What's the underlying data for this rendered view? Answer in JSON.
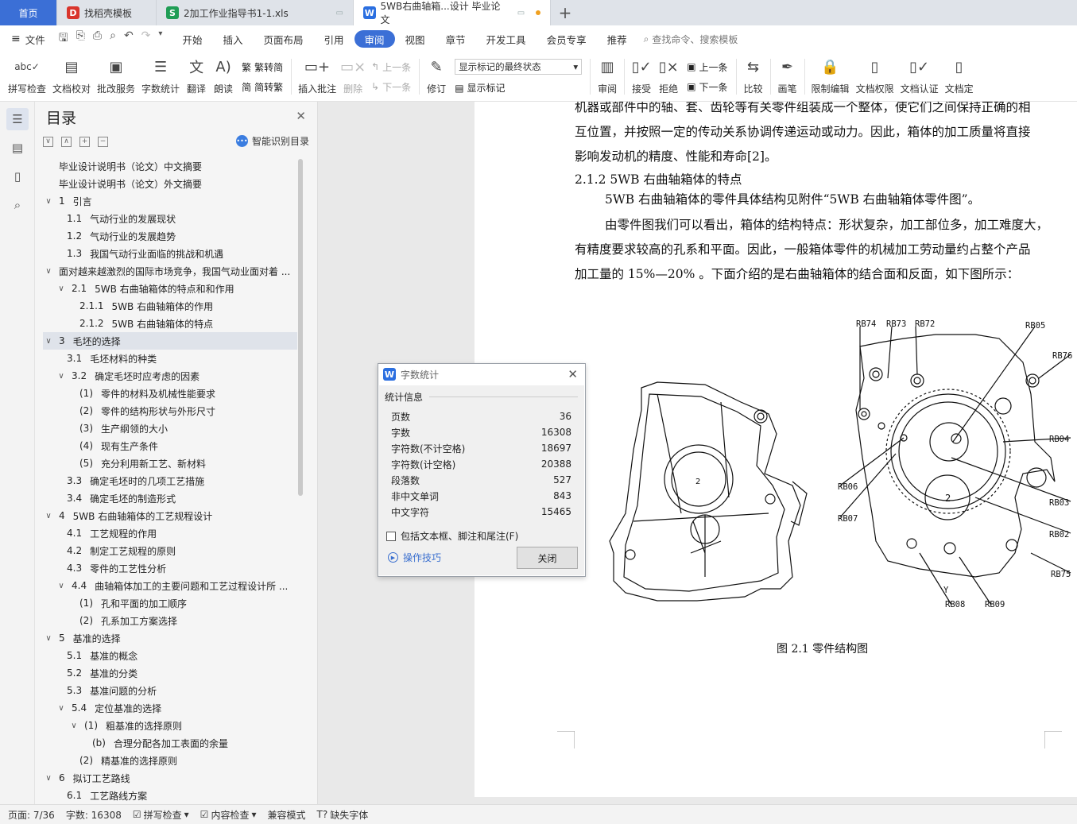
{
  "tabs": {
    "home": "首页",
    "t1": "找稻壳模板",
    "t2": "2加工作业指导书1-1.xls",
    "t3": "5WB右曲轴箱...设计 毕业论文"
  },
  "menu": {
    "file": "文件",
    "items": [
      "开始",
      "插入",
      "页面布局",
      "引用",
      "审阅",
      "视图",
      "章节",
      "开发工具",
      "会员专享",
      "推荐"
    ],
    "search": "查找命令、搜索模板"
  },
  "ribbon": {
    "spell": "拼写检查",
    "proof": "文档校对",
    "batch": "批改服务",
    "wordcount": "字数统计",
    "translate": "翻译",
    "read": "朗读",
    "trad": "繁转简",
    "simp": "简转繁",
    "insert_comment": "插入批注",
    "delete": "删除",
    "prev": "上一条",
    "next": "下一条",
    "revise": "修订",
    "markup_select": "显示标记的最终状态",
    "show_markup": "显示标记",
    "review": "审阅",
    "accept": "接受",
    "reject": "拒绝",
    "prev2": "上一条",
    "next2": "下一条",
    "compare": "比较",
    "pen": "画笔",
    "restrict": "限制编辑",
    "perm": "文档权限",
    "cert": "文档认证",
    "doc_more": "文档定"
  },
  "toc": {
    "title": "目录",
    "smart": "智能识别目录",
    "items": [
      {
        "lvl": 0,
        "arr": "",
        "num": "",
        "text": "毕业设计说明书（论文）中文摘要"
      },
      {
        "lvl": 0,
        "arr": "",
        "num": "",
        "text": "毕业设计说明书（论文）外文摘要"
      },
      {
        "lvl": 0,
        "arr": "∨",
        "num": "1",
        "text": "引言"
      },
      {
        "lvl": 1,
        "arr": "",
        "num": "1.1",
        "text": "气动行业的发展现状"
      },
      {
        "lvl": 1,
        "arr": "",
        "num": "1.2",
        "text": "气动行业的发展趋势"
      },
      {
        "lvl": 1,
        "arr": "",
        "num": "1.3",
        "text": "我国气动行业面临的挑战和机遇"
      },
      {
        "lvl": 0,
        "arr": "∨",
        "num": "",
        "text": "面对越来越激烈的国际市场竞争，我国气动业面对着 ..."
      },
      {
        "lvl": 1,
        "arr": "∨",
        "num": "2.1",
        "text": "5WB 右曲轴箱体的特点和和作用"
      },
      {
        "lvl": 2,
        "arr": "",
        "num": "2.1.1",
        "text": "5WB 右曲轴箱体的作用"
      },
      {
        "lvl": 2,
        "arr": "",
        "num": "2.1.2",
        "text": "5WB 右曲轴箱体的特点"
      },
      {
        "lvl": 0,
        "arr": "∨",
        "num": "3",
        "text": "毛坯的选择",
        "sel": true
      },
      {
        "lvl": 1,
        "arr": "",
        "num": "3.1",
        "text": "毛坯材料的种类"
      },
      {
        "lvl": 1,
        "arr": "∨",
        "num": "3.2",
        "text": "确定毛坯时应考虑的因素"
      },
      {
        "lvl": 2,
        "arr": "",
        "num": "(1)",
        "text": "零件的材料及机械性能要求"
      },
      {
        "lvl": 2,
        "arr": "",
        "num": "(2)",
        "text": "零件的结构形状与外形尺寸"
      },
      {
        "lvl": 2,
        "arr": "",
        "num": "(3)",
        "text": "生产纲领的大小"
      },
      {
        "lvl": 2,
        "arr": "",
        "num": "(4)",
        "text": "现有生产条件"
      },
      {
        "lvl": 2,
        "arr": "",
        "num": "(5)",
        "text": "充分利用新工艺、新材料"
      },
      {
        "lvl": 1,
        "arr": "",
        "num": "3.3",
        "text": "确定毛坯时的几项工艺措施"
      },
      {
        "lvl": 1,
        "arr": "",
        "num": "3.4",
        "text": "确定毛坯的制造形式"
      },
      {
        "lvl": 0,
        "arr": "∨",
        "num": "4",
        "text": "5WB 右曲轴箱体的工艺规程设计"
      },
      {
        "lvl": 1,
        "arr": "",
        "num": "4.1",
        "text": "工艺规程的作用"
      },
      {
        "lvl": 1,
        "arr": "",
        "num": "4.2",
        "text": "制定工艺规程的原则"
      },
      {
        "lvl": 1,
        "arr": "",
        "num": "4.3",
        "text": "零件的工艺性分析"
      },
      {
        "lvl": 1,
        "arr": "∨",
        "num": "4.4",
        "text": "曲轴箱体加工的主要问题和工艺过程设计所 ..."
      },
      {
        "lvl": 2,
        "arr": "",
        "num": "(1)",
        "text": "孔和平面的加工顺序"
      },
      {
        "lvl": 2,
        "arr": "",
        "num": "(2)",
        "text": "孔系加工方案选择"
      },
      {
        "lvl": 0,
        "arr": "∨",
        "num": "5",
        "text": "基准的选择"
      },
      {
        "lvl": 1,
        "arr": "",
        "num": "5.1",
        "text": "基准的概念"
      },
      {
        "lvl": 1,
        "arr": "",
        "num": "5.2",
        "text": "基准的分类"
      },
      {
        "lvl": 1,
        "arr": "",
        "num": "5.3",
        "text": "基准问题的分析"
      },
      {
        "lvl": 1,
        "arr": "∨",
        "num": "5.4",
        "text": "定位基准的选择"
      },
      {
        "lvl": 2,
        "arr": "∨",
        "num": "(1)",
        "text": "粗基准的选择原则"
      },
      {
        "lvl": 3,
        "arr": "",
        "num": "(b)",
        "text": "合理分配各加工表面的余量"
      },
      {
        "lvl": 2,
        "arr": "",
        "num": "(2)",
        "text": "精基准的选择原则"
      },
      {
        "lvl": 0,
        "arr": "∨",
        "num": "6",
        "text": "拟订工艺路线"
      },
      {
        "lvl": 1,
        "arr": "",
        "num": "6.1",
        "text": "工艺路线方案"
      }
    ]
  },
  "doc": {
    "para0_line1": "机器或部件中的轴、套、齿轮等有关零件组装成一个整体，使它们之间保持正确的相",
    "para0_line2": "互位置，并按照一定的传动关系协调传递运动或动力。因此，箱体的加工质量将直接",
    "para0_line3": "影响发动机的精度、性能和寿命[2]。",
    "heading": "2.1.2    5WB 右曲轴箱体的特点",
    "para1": "5WB 右曲轴箱体的零件具体结构见附件“5WB 右曲轴箱体零件图”。",
    "para2_line1": "由零件图我们可以看出，箱体的结构特点：形状复杂，加工部位多，加工难度大，",
    "para2_line2": "有精度要求较高的孔系和平面。因此，一般箱体零件的机械加工劳动量约占整个产品",
    "para2_line3": "加工量的 15%—20% 。下面介绍的是右曲轴箱体的结合面和反面，如下图所示：",
    "caption": "图 2.1    零件结构图",
    "drawing_labels": [
      "RB74",
      "RB73",
      "RB72",
      "RB05",
      "RB76",
      "RB04",
      "RB06",
      "RB03",
      "RB07",
      "RB02",
      "RB75",
      "RB08",
      "RB09",
      "Y",
      "2",
      "2"
    ]
  },
  "dialog": {
    "title": "字数统计",
    "section": "统计信息",
    "stats": [
      {
        "label": "页数",
        "value": "36"
      },
      {
        "label": "字数",
        "value": "16308"
      },
      {
        "label": "字符数(不计空格)",
        "value": "18697"
      },
      {
        "label": "字符数(计空格)",
        "value": "20388"
      },
      {
        "label": "段落数",
        "value": "527"
      },
      {
        "label": "非中文单词",
        "value": "843"
      },
      {
        "label": "中文字符",
        "value": "15465"
      }
    ],
    "checkbox": "包括文本框、脚注和尾注(F)",
    "tips": "操作技巧",
    "close": "关闭"
  },
  "status": {
    "page": "页面: 7/36",
    "words": "字数: 16308",
    "spell": "拼写检查",
    "content": "内容检查",
    "compat": "兼容模式",
    "missing_font": "缺失字体"
  }
}
